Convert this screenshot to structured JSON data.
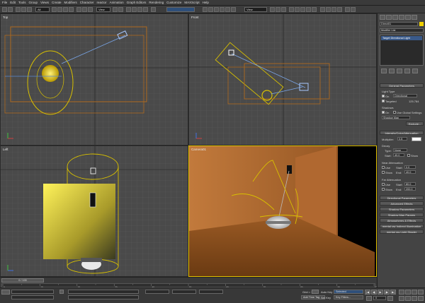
{
  "menu": [
    "File",
    "Edit",
    "Tools",
    "Group",
    "Views",
    "Create",
    "Modifiers",
    "Character",
    "reactor",
    "Animation",
    "Graph Editors",
    "Rendering",
    "Customize",
    "MAXScript",
    "Help"
  ],
  "toolbar": {
    "filter_dd": "All",
    "view_dd1": "View",
    "view_dd2": "View"
  },
  "viewports": {
    "top": "Top",
    "front": "Front",
    "left": "Left",
    "camera": "Camera01"
  },
  "panel": {
    "object_name": "Direct01",
    "modifier_list": "Modifier List",
    "stack_item": "Target Directional Light",
    "general_params": "General Parameters",
    "light_type": "Light Type",
    "on": "On",
    "light_type_value": "Directional",
    "targeted": "Targeted",
    "target_dist": "125.784",
    "shadows": "Shadows",
    "shadows_on": "On",
    "use_global": "Use Global Settings",
    "shadow_map": "Shadow Map",
    "exclude": "Exclude...",
    "intensity": "Intensity/Color/Attenuation",
    "multiplier": "Multiplier:",
    "multiplier_value": "0.5",
    "decay": "Decay",
    "decay_type": "Type:",
    "decay_type_value": "None",
    "decay_start": "Start:",
    "decay_start_value": "40.0",
    "decay_show": "Show",
    "near_atten": "Near Attenuation",
    "near_use": "Use",
    "near_start": "Start:",
    "near_start_value": "0.0",
    "near_show": "Show",
    "near_end": "End:",
    "near_end_value": "40.0",
    "far_atten": "Far Attenuation",
    "far_use": "Use",
    "far_start": "Start:",
    "far_start_value": "80.0",
    "far_show": "Show",
    "far_end": "End:",
    "far_end_value": "200.0",
    "rollouts": [
      "Directional Parameters",
      "Advanced Effects",
      "Shadow Parameters",
      "Shadow Map Params",
      "Atmospheres & Effects",
      "mental ray Indirect Illumination",
      "mental ray Light Shader"
    ]
  },
  "timeline": {
    "frame": "0 / 100",
    "ticks": [
      "0",
      "10",
      "20",
      "30",
      "40",
      "50",
      "60",
      "70",
      "80",
      "90",
      "100"
    ]
  },
  "status": {
    "grid": "Grid = 10.0",
    "add_time_tag": "Add Time Tag",
    "auto_key": "Auto Key",
    "selected": "Selected",
    "set_key": "Set Key",
    "key_filters": "Key Filters...",
    "frame_value": "0"
  },
  "colors": {
    "light_yellow": "#d8c000",
    "wall_orange": "#c27a3c",
    "active_border": "#e0c000"
  }
}
